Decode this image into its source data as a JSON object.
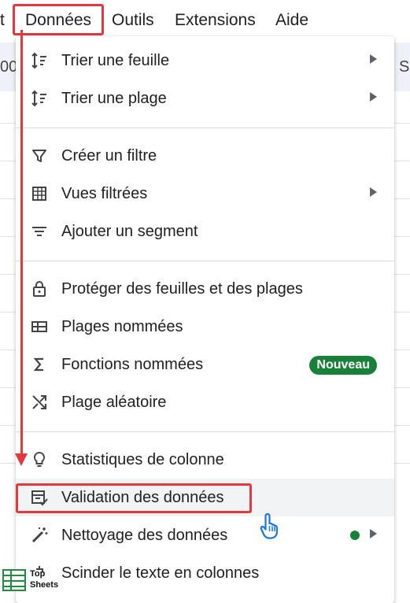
{
  "menubar": {
    "partial_item": "t",
    "items": [
      "Données",
      "Outils",
      "Extensions",
      "Aide"
    ]
  },
  "toolbar": {
    "left_glyph": "00",
    "right_glyph": "S"
  },
  "menu": {
    "sections": [
      [
        {
          "label": "Trier une feuille",
          "icon": "sort-icon",
          "submenu": true
        },
        {
          "label": "Trier une plage",
          "icon": "sort-icon",
          "submenu": true
        }
      ],
      [
        {
          "label": "Créer un filtre",
          "icon": "filter-icon"
        },
        {
          "label": "Vues filtrées",
          "icon": "filter-views-icon",
          "submenu": true
        },
        {
          "label": "Ajouter un segment",
          "icon": "slicer-icon"
        }
      ],
      [
        {
          "label": "Protéger des feuilles et des plages",
          "icon": "lock-icon"
        },
        {
          "label": "Plages nommées",
          "icon": "named-ranges-icon"
        },
        {
          "label": "Fonctions nommées",
          "icon": "sigma-icon",
          "badge": "Nouveau"
        },
        {
          "label": "Plage aléatoire",
          "icon": "shuffle-icon"
        }
      ],
      [
        {
          "label": "Statistiques de colonne",
          "icon": "lightbulb-icon"
        },
        {
          "label": "Validation des données",
          "icon": "data-validation-icon",
          "highlighted": true
        },
        {
          "label": "Nettoyage des données",
          "icon": "magic-wand-icon",
          "submenu": true,
          "dot": true
        },
        {
          "label": "Scinder le texte en colonnes",
          "icon": "split-icon"
        }
      ]
    ]
  },
  "watermark": {
    "line1": "Top",
    "line2": "Sheets"
  },
  "colors": {
    "highlight_red": "#e2383f",
    "badge_green": "#188038"
  }
}
